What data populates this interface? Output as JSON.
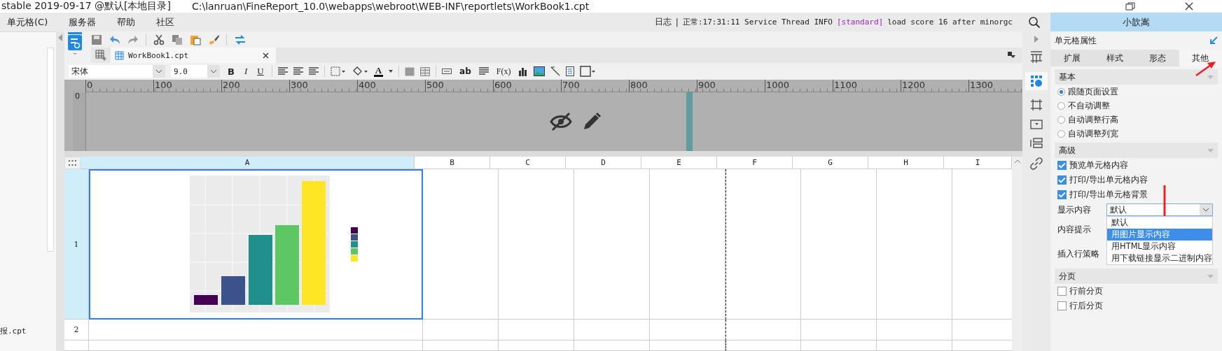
{
  "title_bar": {
    "version": "stable 2019-09-17 @默认[本地目录]",
    "path": "C:\\lanruan\\FineReport_10.0\\webapps\\webroot\\WEB-INF\\reportlets\\WorkBook1.cpt"
  },
  "menu": [
    "单元格(C)",
    "服务器",
    "帮助",
    "社区"
  ],
  "log": {
    "label": "日志",
    "separator": "|",
    "message": "正常:17:31:11 Service Thread INFO",
    "tag": "[standard]",
    "detail": "load score 16 after minorgc"
  },
  "user": "小歆嵩",
  "file_list": [
    "报.cpt"
  ],
  "tabs": [
    {
      "label": "WorkBook1.cpt",
      "selected": true
    }
  ],
  "format_bar": {
    "font": "宋体",
    "size": "9.0",
    "style_buttons": [
      "B",
      "I",
      "U"
    ],
    "color_button": "A",
    "wrap_button": "ab",
    "formula_button": "F(x)"
  },
  "ruler": {
    "ticks": [
      "0",
      "100",
      "200",
      "300",
      "400",
      "500",
      "600",
      "700",
      "800",
      "900",
      "1000",
      "1100",
      "1200",
      "1300"
    ],
    "vertical": "0"
  },
  "sheet": {
    "columns": [
      {
        "label": "A",
        "selected": true
      },
      {
        "label": "B",
        "selected": false
      },
      {
        "label": "C",
        "selected": false
      },
      {
        "label": "D",
        "selected": false
      },
      {
        "label": "E",
        "selected": false
      },
      {
        "label": "F",
        "selected": false
      },
      {
        "label": "G",
        "selected": false
      },
      {
        "label": "H",
        "selected": false
      },
      {
        "label": "I",
        "selected": false
      }
    ],
    "rows": [
      {
        "label": "1",
        "selected": true
      },
      {
        "label": "2",
        "selected": false
      }
    ]
  },
  "properties": {
    "title": "单元格属性",
    "tabs": [
      {
        "label": "扩展",
        "selected": false
      },
      {
        "label": "样式",
        "selected": false
      },
      {
        "label": "形态",
        "selected": false
      },
      {
        "label": "其他",
        "selected": true
      }
    ],
    "sections": [
      {
        "title": "基本",
        "items": [
          {
            "kind": "radio",
            "label": "跟随页面设置",
            "selected": true
          },
          {
            "kind": "radio",
            "label": "不自动调整",
            "selected": false
          },
          {
            "kind": "radio",
            "label": "自动调整行高",
            "selected": false
          },
          {
            "kind": "radio",
            "label": "自动调整列宽",
            "selected": false
          }
        ]
      },
      {
        "title": "高级",
        "items": [
          {
            "kind": "checkbox",
            "label": "预览单元格内容",
            "checked": true
          },
          {
            "kind": "checkbox",
            "label": "打印/导出单元格内容",
            "checked": true
          },
          {
            "kind": "checkbox",
            "label": "打印/导出单元格背景",
            "checked": true
          },
          {
            "kind": "select",
            "label": "显示内容",
            "value": "默认",
            "expanded": true,
            "options": [
              {
                "label": "默认",
                "highlighted": false
              },
              {
                "label": "用图片显示内容",
                "highlighted": true
              },
              {
                "label": "用HTML显示内容",
                "highlighted": false
              },
              {
                "label": "用下载链接显示二进制内容",
                "highlighted": false
              }
            ]
          },
          {
            "kind": "label",
            "label": "内容提示"
          },
          {
            "kind": "label",
            "label": "插入行策略"
          }
        ]
      },
      {
        "title": "分页",
        "items": [
          {
            "kind": "checkbox",
            "label": "行前分页",
            "checked": false
          },
          {
            "kind": "checkbox",
            "label": "行后分页",
            "checked": false
          }
        ]
      }
    ]
  }
}
